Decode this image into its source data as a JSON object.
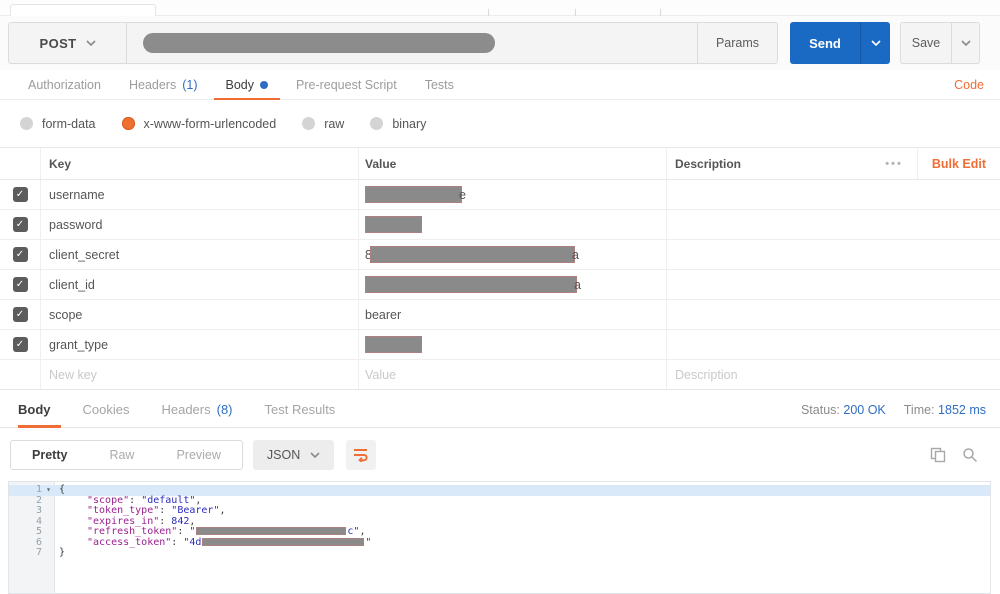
{
  "accent": {
    "orange": "#f06d35",
    "blue": "#2e6ec2",
    "send_blue": "#1a6ac4"
  },
  "request_bar": {
    "method": "POST",
    "url_redacted": true,
    "params_label": "Params",
    "send_label": "Send",
    "save_label": "Save"
  },
  "request_tabs": {
    "items": [
      {
        "label": "Authorization",
        "count": ""
      },
      {
        "label": "Headers",
        "count": "(1)"
      },
      {
        "label": "Body",
        "count": "",
        "active": true
      },
      {
        "label": "Pre-request Script",
        "count": ""
      },
      {
        "label": "Tests",
        "count": ""
      }
    ],
    "code_link": "Code"
  },
  "body_type_options": {
    "items": [
      {
        "label": "form-data",
        "selected": false
      },
      {
        "label": "x-www-form-urlencoded",
        "selected": true
      },
      {
        "label": "raw",
        "selected": false
      },
      {
        "label": "binary",
        "selected": false
      }
    ]
  },
  "params_table": {
    "headers": {
      "key": "Key",
      "value": "Value",
      "description": "Description"
    },
    "more_label": "•••",
    "bulk_edit_label": "Bulk Edit",
    "rows": [
      {
        "key": "username",
        "checked": true,
        "value_redacted": true,
        "value_suffix": "e"
      },
      {
        "key": "password",
        "checked": true,
        "value_redacted": true
      },
      {
        "key": "client_secret",
        "checked": true,
        "value_prefix": "8",
        "value_redacted": true,
        "value_suffix": "a"
      },
      {
        "key": "client_id",
        "checked": true,
        "value_redacted": true,
        "value_suffix": "a"
      },
      {
        "key": "scope",
        "checked": true,
        "value_text": "bearer"
      },
      {
        "key": "grant_type",
        "checked": true,
        "value_redacted": true
      }
    ],
    "new_row": {
      "key_placeholder": "New key",
      "value_placeholder": "Value",
      "description_placeholder": "Description"
    }
  },
  "response_tabs": {
    "items": [
      {
        "label": "Body",
        "count": "",
        "active": true
      },
      {
        "label": "Cookies",
        "count": ""
      },
      {
        "label": "Headers",
        "count": "(8)"
      },
      {
        "label": "Test Results",
        "count": ""
      }
    ]
  },
  "response_meta": {
    "status_label": "Status:",
    "status_value": "200 OK",
    "time_label": "Time:",
    "time_value": "1852 ms"
  },
  "response_toolbar": {
    "views": {
      "pretty": "Pretty",
      "raw": "Raw",
      "preview": "Preview"
    },
    "active_view": "Pretty",
    "format": "JSON"
  },
  "response_body": {
    "lines": [
      {
        "num": "1",
        "fold": true,
        "highlight": true,
        "tokens": [
          {
            "t": "punct",
            "v": "{"
          }
        ]
      },
      {
        "num": "2",
        "indent": true,
        "tokens": [
          {
            "t": "key",
            "v": "\"scope\""
          },
          {
            "t": "punct",
            "v": ": "
          },
          {
            "t": "str",
            "v": "\"default\""
          },
          {
            "t": "punct",
            "v": ","
          }
        ]
      },
      {
        "num": "3",
        "indent": true,
        "tokens": [
          {
            "t": "key",
            "v": "\"token_type\""
          },
          {
            "t": "punct",
            "v": ": "
          },
          {
            "t": "str",
            "v": "\"Bearer\""
          },
          {
            "t": "punct",
            "v": ","
          }
        ]
      },
      {
        "num": "4",
        "indent": true,
        "tokens": [
          {
            "t": "key",
            "v": "\"expires_in\""
          },
          {
            "t": "punct",
            "v": ": "
          },
          {
            "t": "num",
            "v": "842"
          },
          {
            "t": "punct",
            "v": ","
          }
        ]
      },
      {
        "num": "5",
        "indent": true,
        "tokens": [
          {
            "t": "key",
            "v": "\"refresh_token\""
          },
          {
            "t": "punct",
            "v": ": "
          },
          {
            "t": "str",
            "v": "\""
          },
          {
            "t": "redacted",
            "w": 150
          },
          {
            "t": "str",
            "v": "c\""
          },
          {
            "t": "punct",
            "v": ","
          }
        ]
      },
      {
        "num": "6",
        "indent": true,
        "tokens": [
          {
            "t": "key",
            "v": "\"access_token\""
          },
          {
            "t": "punct",
            "v": ": "
          },
          {
            "t": "str",
            "v": "\"4d"
          },
          {
            "t": "redacted",
            "w": 162
          },
          {
            "t": "str",
            "v": "\""
          }
        ]
      },
      {
        "num": "7",
        "tokens": [
          {
            "t": "punct",
            "v": "}"
          }
        ]
      }
    ]
  }
}
